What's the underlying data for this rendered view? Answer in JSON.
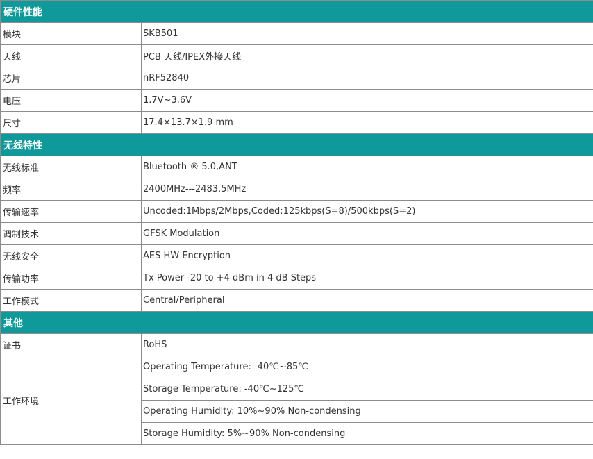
{
  "sections": [
    {
      "title": "硬件性能",
      "rows": [
        {
          "label": "模块",
          "value": "SKB501"
        },
        {
          "label": "天线",
          "value": "PCB 天线/IPEX外接天线"
        },
        {
          "label": "芯片",
          "value": "nRF52840"
        },
        {
          "label": "电压",
          "value": "1.7V~3.6V"
        },
        {
          "label": "尺寸",
          "value": "17.4×13.7×1.9 mm"
        }
      ]
    },
    {
      "title": "无线特性",
      "rows": [
        {
          "label": "无线标准",
          "value": "Bluetooth ® 5.0,ANT"
        },
        {
          "label": "频率",
          "value": "2400MHz---2483.5MHz"
        },
        {
          "label": "传输速率",
          "value": "Uncoded:1Mbps/2Mbps,Coded:125kbps(S=8)/500kbps(S=2)"
        },
        {
          "label": "调制技术",
          "value": "GFSK Modulation"
        },
        {
          "label": "无线安全",
          "value": "AES HW Encryption"
        },
        {
          "label": "传输功率",
          "value": "Tx Power -20 to +4 dBm in 4 dB Steps"
        },
        {
          "label": "工作模式",
          "value": "Central/Peripheral"
        }
      ]
    },
    {
      "title": "其他",
      "rows": [
        {
          "label": "证书",
          "value": "RoHS"
        }
      ],
      "env": {
        "label": "工作环境",
        "values": [
          "Operating Temperature: -40℃~85℃",
          "Storage Temperature: -40℃~125℃",
          "Operating Humidity: 10%~90% Non-condensing",
          "Storage Humidity: 5%~90% Non-condensing"
        ]
      }
    }
  ]
}
